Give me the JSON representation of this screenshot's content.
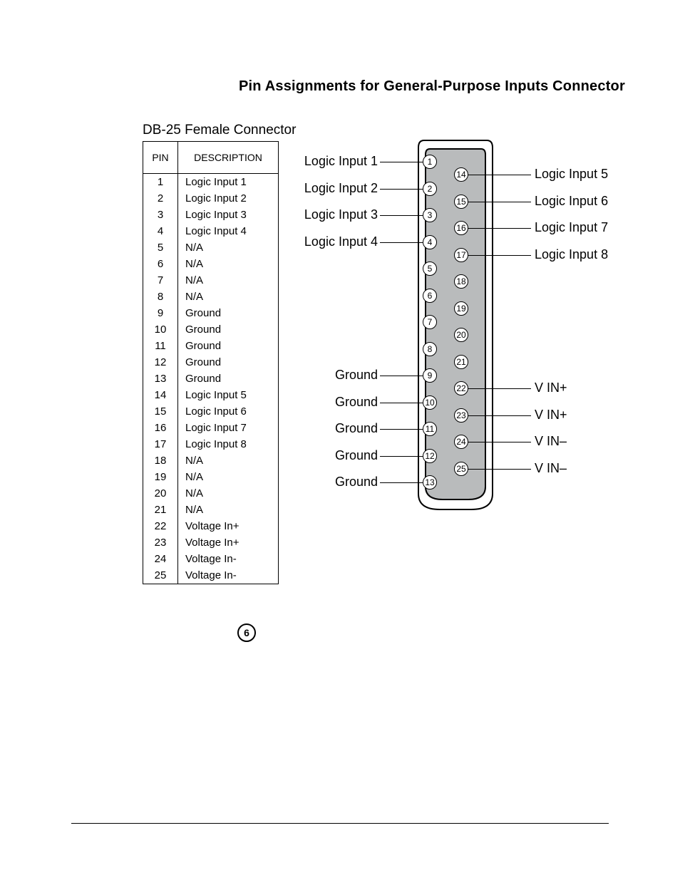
{
  "heading": "Pin Assignments for General-Purpose Inputs Connector",
  "subheading": "DB-25 Female Connector",
  "table": {
    "headers": {
      "pin": "PIN",
      "desc": "DESCRIPTION"
    },
    "rows": [
      {
        "pin": "1",
        "desc": "Logic Input 1"
      },
      {
        "pin": "2",
        "desc": "Logic Input 2"
      },
      {
        "pin": "3",
        "desc": "Logic Input 3"
      },
      {
        "pin": "4",
        "desc": "Logic Input 4"
      },
      {
        "pin": "5",
        "desc": "N/A"
      },
      {
        "pin": "6",
        "desc": "N/A"
      },
      {
        "pin": "7",
        "desc": "N/A"
      },
      {
        "pin": "8",
        "desc": "N/A"
      },
      {
        "pin": "9",
        "desc": "Ground"
      },
      {
        "pin": "10",
        "desc": "Ground"
      },
      {
        "pin": "11",
        "desc": "Ground"
      },
      {
        "pin": "12",
        "desc": "Ground"
      },
      {
        "pin": "13",
        "desc": "Ground"
      },
      {
        "pin": "14",
        "desc": "Logic Input 5"
      },
      {
        "pin": "15",
        "desc": "Logic Input 6"
      },
      {
        "pin": "16",
        "desc": "Logic Input 7"
      },
      {
        "pin": "17",
        "desc": "Logic Input 8"
      },
      {
        "pin": "18",
        "desc": "N/A"
      },
      {
        "pin": "19",
        "desc": "N/A"
      },
      {
        "pin": "20",
        "desc": "N/A"
      },
      {
        "pin": "21",
        "desc": "N/A"
      },
      {
        "pin": "22",
        "desc": "Voltage In+"
      },
      {
        "pin": "23",
        "desc": "Voltage In+"
      },
      {
        "pin": "24",
        "desc": "Voltage In-"
      },
      {
        "pin": "25",
        "desc": "Voltage In-"
      }
    ]
  },
  "diagram": {
    "left_col": {
      "pins": [
        "1",
        "2",
        "3",
        "4",
        "5",
        "6",
        "7",
        "8",
        "9",
        "10",
        "11",
        "12",
        "13"
      ],
      "labels": [
        {
          "pin": "1",
          "text": "Logic Input 1"
        },
        {
          "pin": "2",
          "text": "Logic Input 2"
        },
        {
          "pin": "3",
          "text": "Logic Input 3"
        },
        {
          "pin": "4",
          "text": "Logic Input 4"
        },
        {
          "pin": "9",
          "text": "Ground"
        },
        {
          "pin": "10",
          "text": "Ground"
        },
        {
          "pin": "11",
          "text": "Ground"
        },
        {
          "pin": "12",
          "text": "Ground"
        },
        {
          "pin": "13",
          "text": "Ground"
        }
      ]
    },
    "right_col": {
      "pins": [
        "14",
        "15",
        "16",
        "17",
        "18",
        "19",
        "20",
        "21",
        "22",
        "23",
        "24",
        "25"
      ],
      "labels": [
        {
          "pin": "14",
          "text": "Logic Input 5"
        },
        {
          "pin": "15",
          "text": "Logic Input 6"
        },
        {
          "pin": "16",
          "text": "Logic Input 7"
        },
        {
          "pin": "17",
          "text": "Logic Input 8"
        },
        {
          "pin": "22",
          "text": "V IN+"
        },
        {
          "pin": "23",
          "text": "V IN+"
        },
        {
          "pin": "24",
          "text": "V IN–"
        },
        {
          "pin": "25",
          "text": "V IN–"
        }
      ]
    }
  },
  "page_number": "6"
}
